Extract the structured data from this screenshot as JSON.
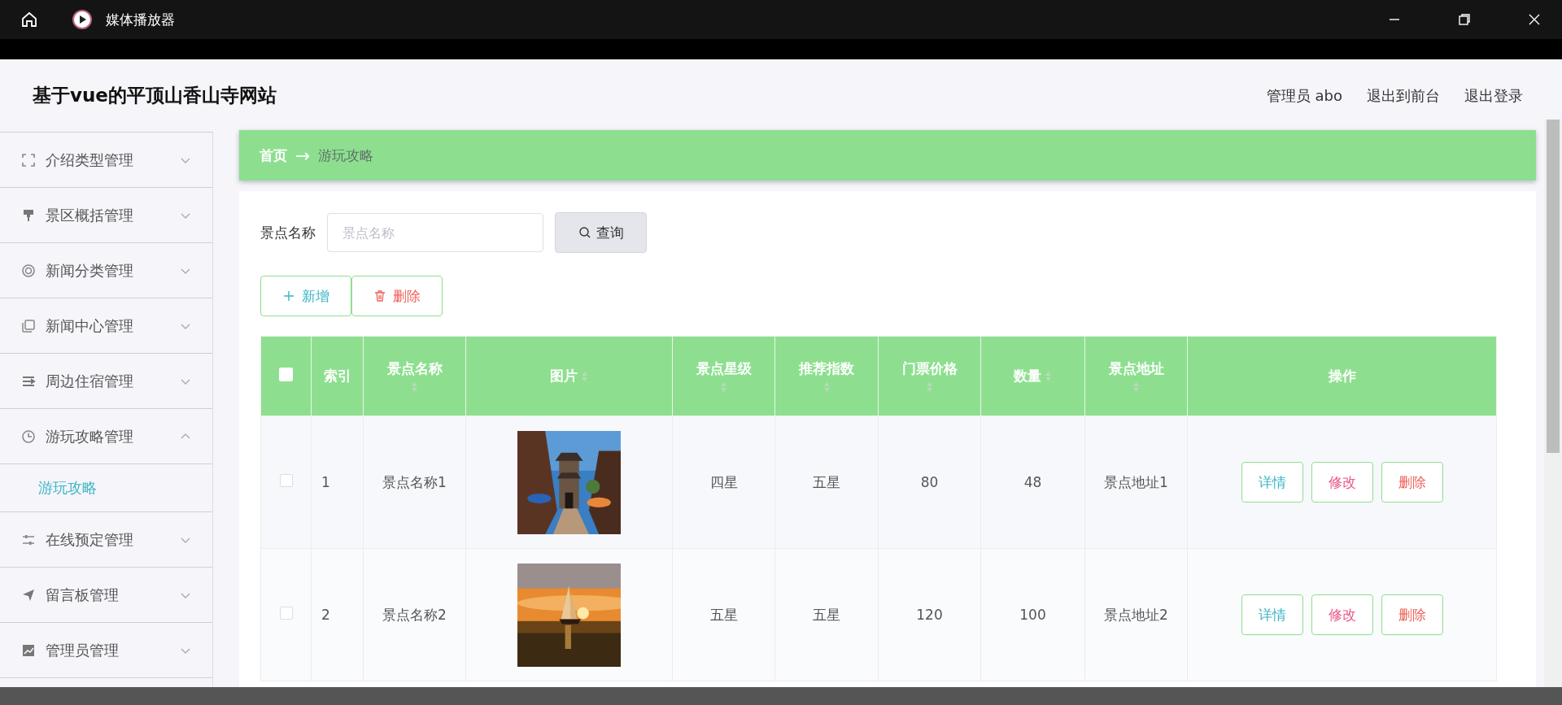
{
  "window": {
    "title": "媒体播放器"
  },
  "header": {
    "site_title": "基于vue的平顶山香山寺网站",
    "links": [
      "管理员 abo",
      "退出到前台",
      "退出登录"
    ]
  },
  "sidebar": {
    "items": [
      {
        "label": "介绍类型管理",
        "expanded": false
      },
      {
        "label": "景区概括管理",
        "expanded": false
      },
      {
        "label": "新闻分类管理",
        "expanded": false
      },
      {
        "label": "新闻中心管理",
        "expanded": false
      },
      {
        "label": "周边住宿管理",
        "expanded": false
      },
      {
        "label": "游玩攻略管理",
        "expanded": true,
        "children": [
          {
            "label": "游玩攻略",
            "selected": true
          }
        ]
      },
      {
        "label": "在线预定管理",
        "expanded": false
      },
      {
        "label": "留言板管理",
        "expanded": false
      },
      {
        "label": "管理员管理",
        "expanded": false
      }
    ]
  },
  "breadcrumb": {
    "items": [
      "首页",
      "游玩攻略"
    ],
    "separator": "→"
  },
  "search": {
    "label": "景点名称",
    "placeholder": "景点名称",
    "button": "查询"
  },
  "actions": [
    {
      "kind": "add",
      "label": "新增"
    },
    {
      "kind": "delete",
      "label": "删除"
    }
  ],
  "table": {
    "header_checked": false,
    "columns": [
      {
        "label": "索引",
        "sortable": false
      },
      {
        "label": "景点名称",
        "sortable": true
      },
      {
        "label": "图片",
        "sortable": true
      },
      {
        "label": "景点星级",
        "sortable": true
      },
      {
        "label": "推荐指数",
        "sortable": true
      },
      {
        "label": "门票价格",
        "sortable": true
      },
      {
        "label": "数量",
        "sortable": true
      },
      {
        "label": "景点地址",
        "sortable": true
      },
      {
        "label": "操作",
        "sortable": false
      }
    ],
    "rows": [
      {
        "selected": false,
        "cells": [
          "1",
          "景点名称1",
          {
            "kind": "picture"
          },
          "四星",
          "五星",
          "80",
          "48",
          "景点地址1"
        ],
        "actions": [
          {
            "kind": "detail",
            "label": "详情"
          },
          {
            "kind": "edit",
            "label": "修改"
          },
          {
            "kind": "delete",
            "label": "删除"
          }
        ]
      },
      {
        "selected": false,
        "cells": [
          "2",
          "景点名称2",
          {
            "kind": "picture"
          },
          "五星",
          "五星",
          "120",
          "100",
          "景点地址2"
        ],
        "actions": [
          {
            "kind": "detail",
            "label": "详情"
          },
          {
            "kind": "edit",
            "label": "修改"
          },
          {
            "kind": "delete",
            "label": "删除"
          }
        ]
      }
    ]
  }
}
